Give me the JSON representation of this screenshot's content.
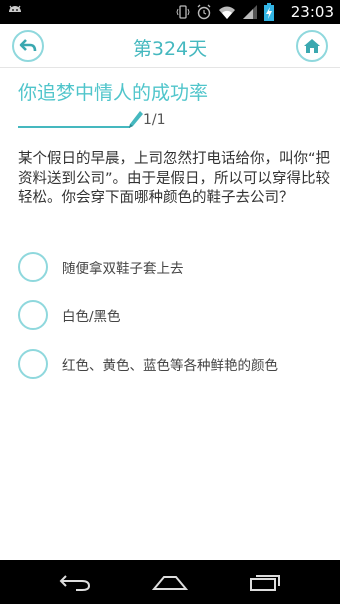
{
  "status_bar": {
    "time": "23:03",
    "icons": [
      "android-icon",
      "vibrate-icon",
      "alarm-icon",
      "wifi-icon",
      "signal-icon",
      "battery-charging-icon"
    ]
  },
  "header": {
    "title": "第324天",
    "back_icon": "back-arrow-icon",
    "home_icon": "home-icon"
  },
  "test": {
    "title": "你追梦中情人的成功率",
    "progress": "1/1",
    "question": "某个假日的早晨，上司忽然打电话给你，叫你“把资料送到公司”。由于是假日，所以可以穿得比较轻松。你会穿下面哪种颜色的鞋子去公司？",
    "options": [
      {
        "label": "随便拿双鞋子套上去"
      },
      {
        "label": "白色/黑色"
      },
      {
        "label": "红色、黄色、蓝色等各种鲜艳的颜色"
      }
    ]
  },
  "colors": {
    "accent": "#45b8bf",
    "radio_border": "#8fd8dd",
    "status_bar": "#000000",
    "battery_fill": "#33b5e5"
  },
  "nav_bar": {
    "icons": [
      "back-nav-icon",
      "home-nav-icon",
      "recents-nav-icon"
    ]
  }
}
